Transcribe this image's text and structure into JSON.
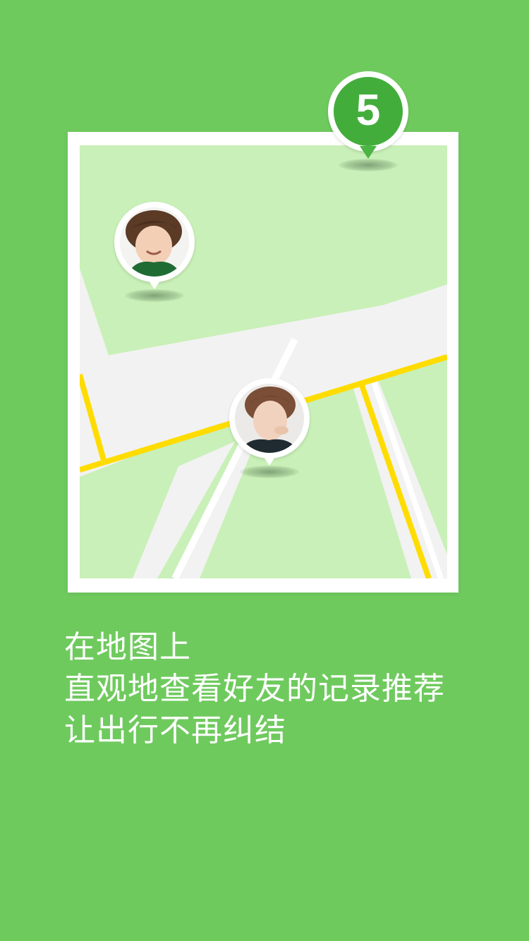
{
  "page": {
    "background_color": "#6fca5e"
  },
  "map": {
    "land_color": "#c9f0b8",
    "road_color": "#f2f2f2",
    "line_color": "#ffdc00",
    "frame_color": "#ffffff",
    "pins": [
      {
        "type": "count",
        "value": "5",
        "color": "#43ad3c"
      },
      {
        "type": "avatar",
        "name": "friend-avatar-1"
      },
      {
        "type": "avatar",
        "name": "friend-avatar-2"
      }
    ]
  },
  "caption": {
    "line1": "在地图上",
    "line2": "直观地查看好友的记录推荐",
    "line3": "让出行不再纠结"
  }
}
